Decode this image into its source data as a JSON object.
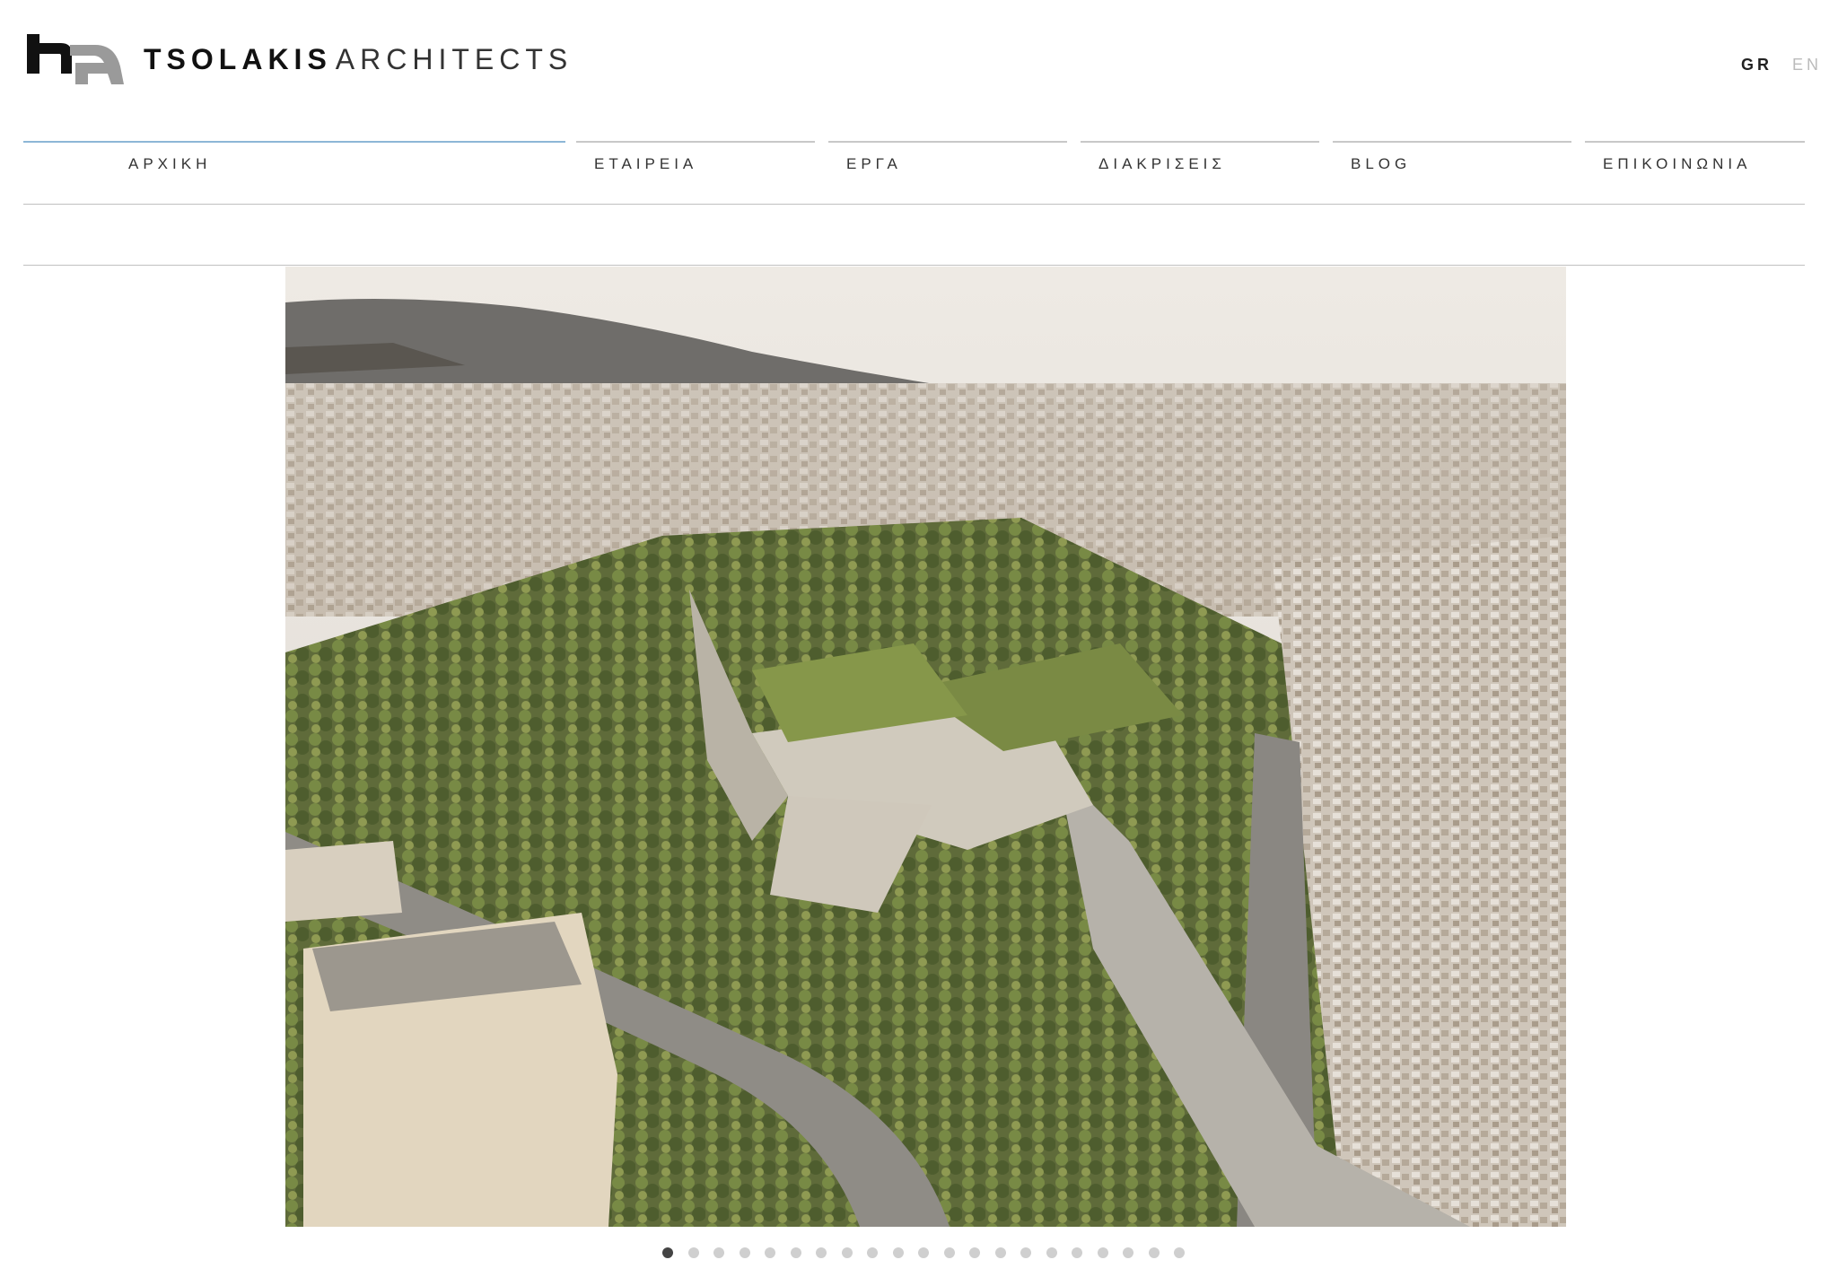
{
  "header": {
    "brand_bold": "TSOLAKIS",
    "brand_light": "ARCHITECTS",
    "lang_gr": "GR",
    "lang_en": "EN"
  },
  "nav": {
    "items": [
      {
        "label": "ΑΡΧΙΚΗ"
      },
      {
        "label": "ΕΤΑΙΡΕΙΑ"
      },
      {
        "label": "ΕΡΓΑ"
      },
      {
        "label": "ΔΙΑΚΡΙΣΕΙΣ"
      },
      {
        "label": "BLOG"
      },
      {
        "label": "ΕΠΙΚΟΙΝΩΝΙΑ"
      }
    ],
    "active_index": 0
  },
  "slider": {
    "slide_count": 21,
    "active_slide": 1
  },
  "colors": {
    "active_nav_line": "#8db6d6",
    "inactive_nav_line": "#c8c8c8",
    "dot_active": "#444444",
    "dot_inactive": "#cfcfcf"
  }
}
